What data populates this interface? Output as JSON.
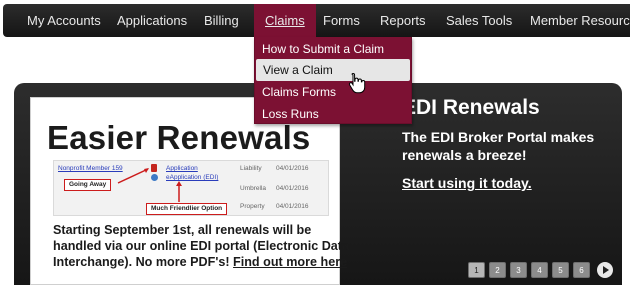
{
  "nav": {
    "items": [
      {
        "label": "My Accounts"
      },
      {
        "label": "Applications"
      },
      {
        "label": "Billing"
      },
      {
        "label": "Claims"
      },
      {
        "label": "Forms"
      },
      {
        "label": "Reports"
      },
      {
        "label": "Sales Tools"
      },
      {
        "label": "Member Resources"
      }
    ],
    "active": "Claims"
  },
  "claims_menu": {
    "items": [
      {
        "label": "How to Submit a Claim"
      },
      {
        "label": "View a Claim"
      },
      {
        "label": "Claims Forms"
      },
      {
        "label": "Loss Runs"
      }
    ],
    "hovered": "View a Claim"
  },
  "banner": {
    "ad": {
      "title": "Easier Renewals",
      "mock": {
        "member_link": "Nonprofit Member 159",
        "application_link": "Application",
        "eapplication_link": "eApplication (EDI)",
        "callout_left": "Going Away",
        "callout_bottom": "Much Friendlier Option",
        "rows": [
          {
            "type": "Liability",
            "date": "04/01/2016"
          },
          {
            "type": "Umbrella",
            "date": "04/01/2016"
          },
          {
            "type": "Property",
            "date": "04/01/2016"
          }
        ]
      },
      "body_line1": "Starting September 1st, all renewals will be",
      "body_line2": "handled via our online EDI portal (Electronic Data",
      "body_line3": "Interchange). No more PDF's! ",
      "body_link": "Find out more here"
    },
    "headline": "EDI Renewals",
    "subhead_line1": "The EDI Broker Portal makes",
    "subhead_line2": "renewals a breeze!",
    "cta": "Start using it today.",
    "pager": {
      "pages": [
        "1",
        "2",
        "3",
        "4",
        "5",
        "6"
      ],
      "current": "1"
    }
  },
  "colors": {
    "nav_bg": "#1e1e1e",
    "active_accent": "#7c1133",
    "hover_bg": "#e6e6e6",
    "banner_bg": "#222222"
  },
  "icons": [
    "pdf-icon",
    "e-application-icon",
    "arrow-up-icon",
    "arrow-left-icon",
    "play-icon",
    "hand-pointer-icon"
  ]
}
